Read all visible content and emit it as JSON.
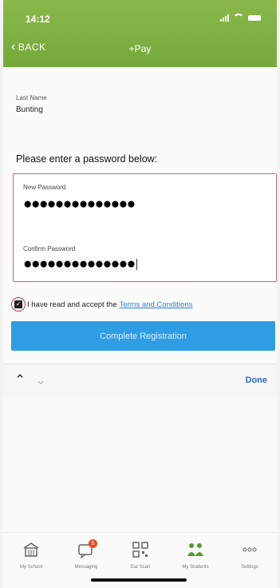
{
  "status": {
    "time": "14:12"
  },
  "nav": {
    "back_label": "BACK",
    "title": "+Pay"
  },
  "last_name": {
    "label": "Last Name",
    "value": "Bunting"
  },
  "password_prompt": "Please enter a password below:",
  "new_password": {
    "label": "New Password",
    "value": "●●●●●●●●●●●●●●"
  },
  "confirm_password": {
    "label": "Confirm Password",
    "value": "●●●●●●●●●●●●●●"
  },
  "terms": {
    "text": "I have read and accept the",
    "link": "Terms and Conditions",
    "checked": true
  },
  "complete_button": "Complete Registration",
  "keyboard_toolbar": {
    "done": "Done"
  },
  "tabs": [
    {
      "label": "My School",
      "icon": "school-icon"
    },
    {
      "label": "Messaging",
      "icon": "messaging-icon",
      "badge": "5"
    },
    {
      "label": "Eat Scan",
      "icon": "qr-scan-icon"
    },
    {
      "label": "My Students",
      "icon": "students-icon"
    },
    {
      "label": "Settings",
      "icon": "more-icon"
    }
  ],
  "colors": {
    "header": "#7fb243",
    "button": "#2f9de4",
    "error_border": "#c46a77",
    "link": "#2e7fd6",
    "badge": "#e54a24"
  }
}
